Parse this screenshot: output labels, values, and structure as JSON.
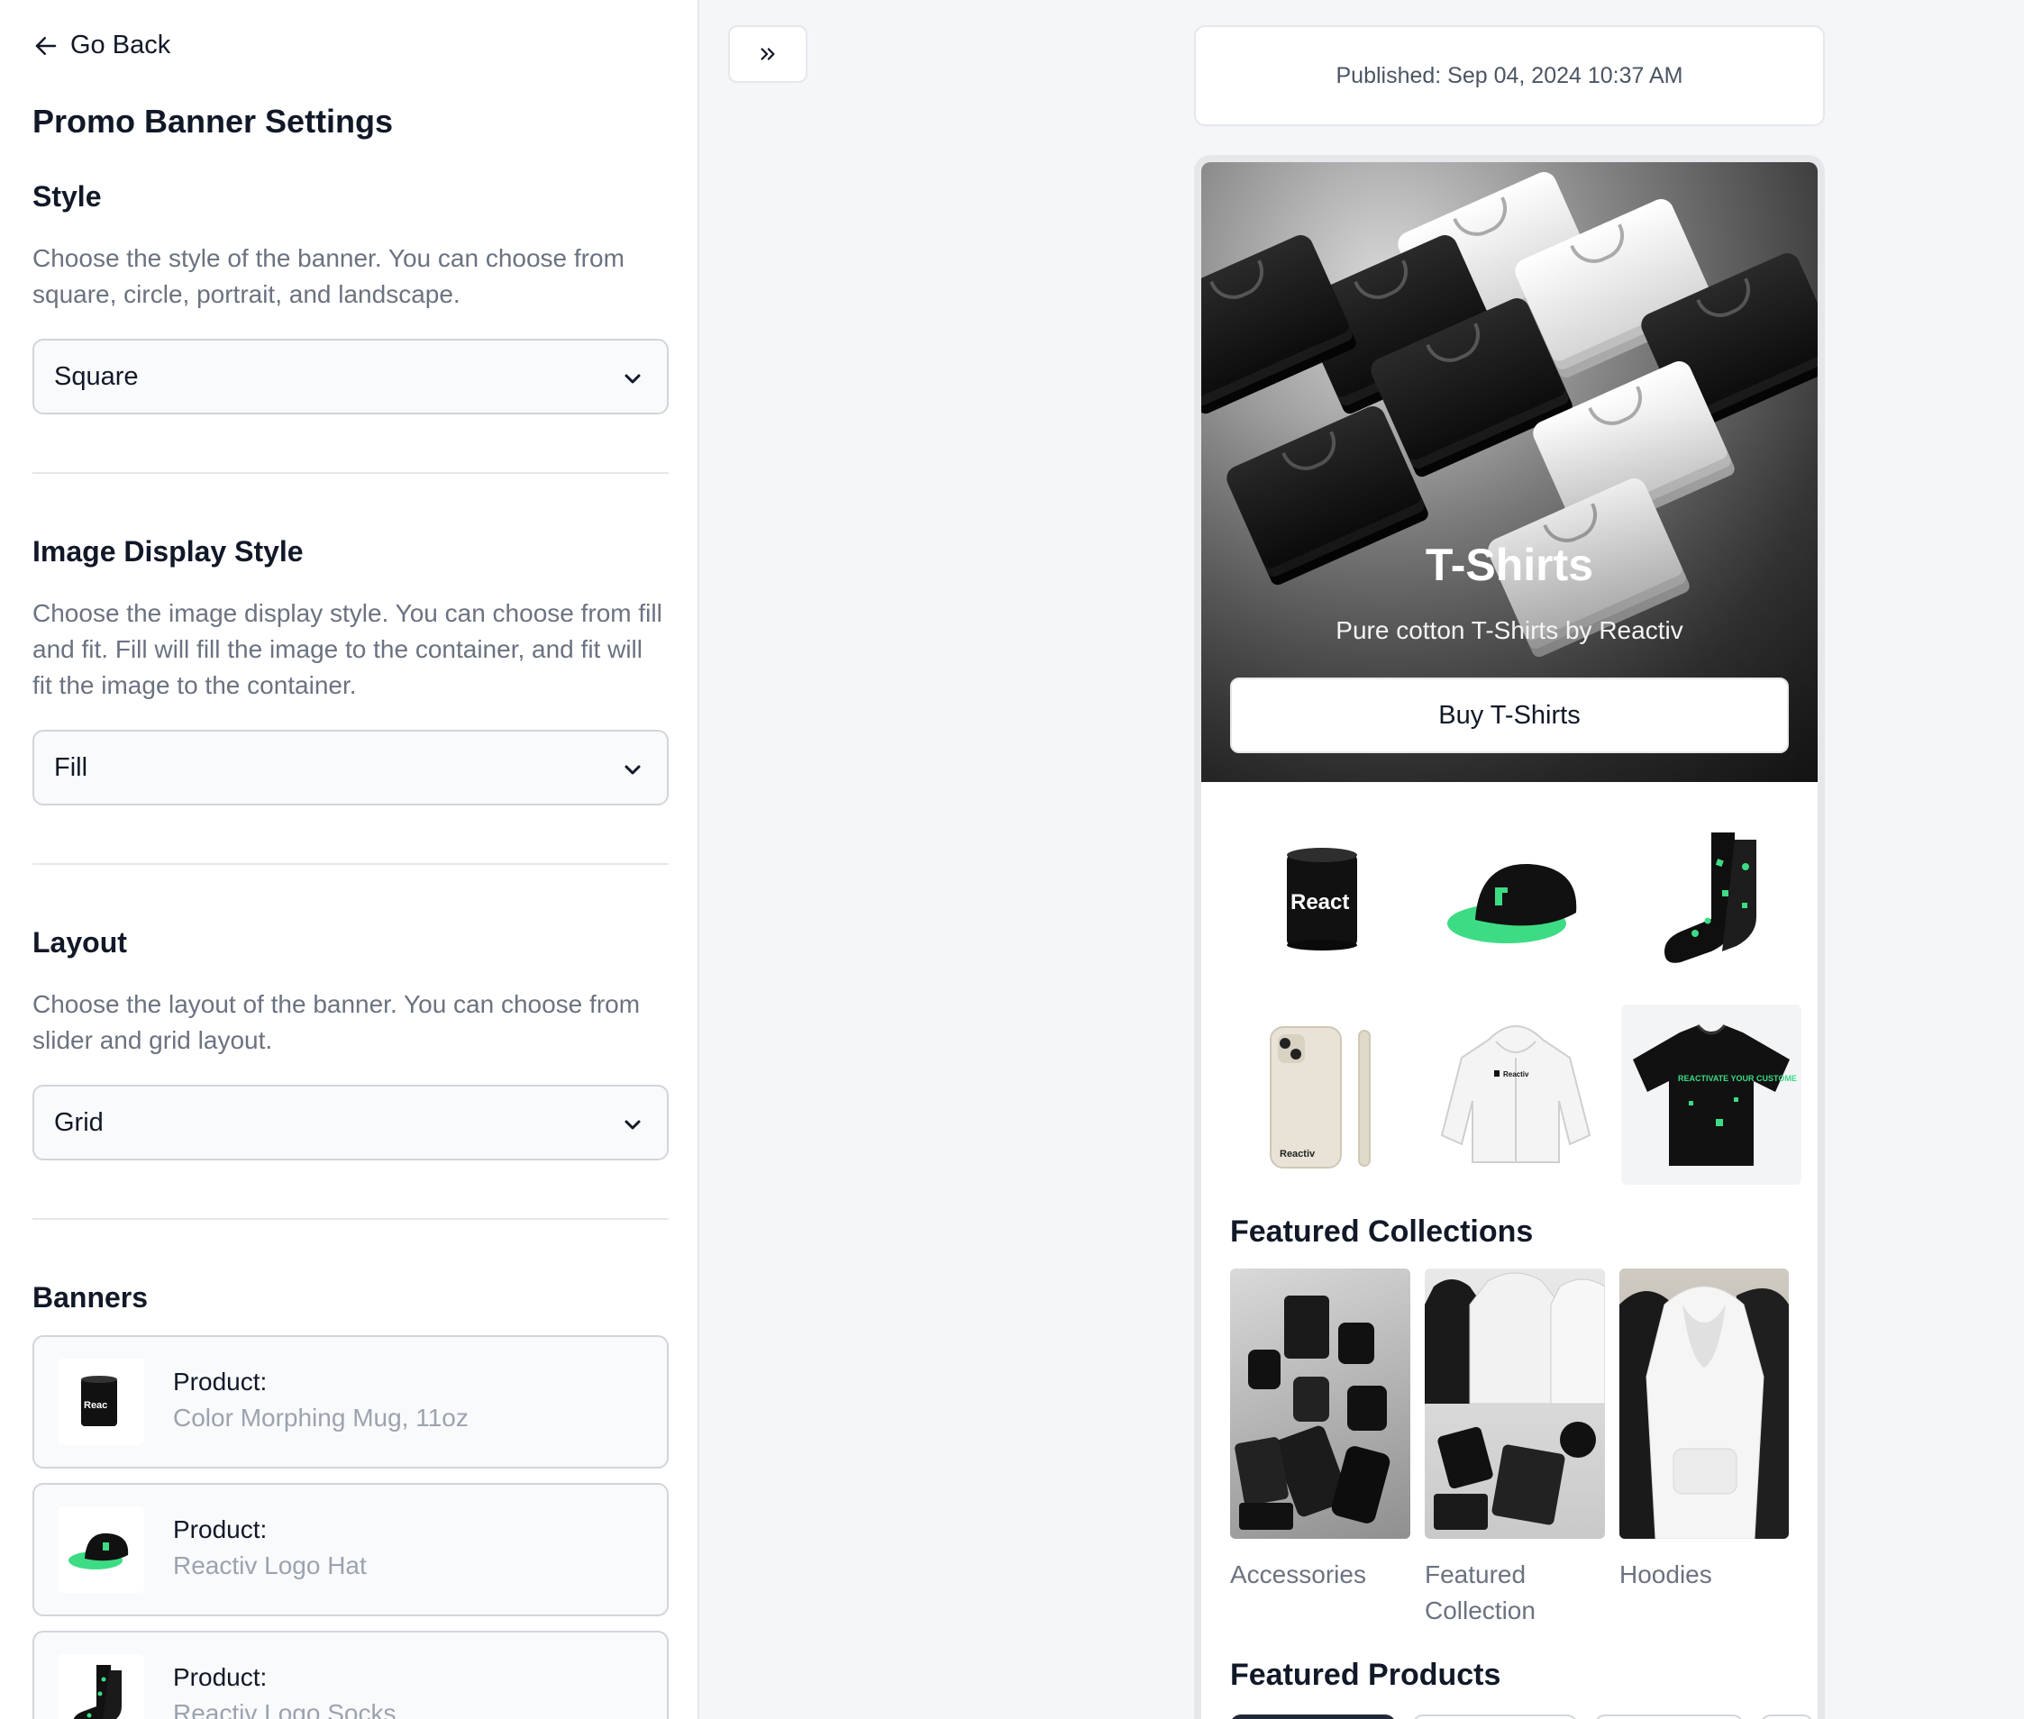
{
  "nav": {
    "back_label": "Go Back"
  },
  "panel": {
    "title": "Promo Banner Settings",
    "style": {
      "title": "Style",
      "description": "Choose the style of the banner. You can choose from square, circle, portrait, and landscape.",
      "value": "Square"
    },
    "image_display": {
      "title": "Image Display Style",
      "description": "Choose the image display style. You can choose from fill and fit. Fill will fill the image to the container, and fit will fit the image to the container.",
      "value": "Fill"
    },
    "layout": {
      "title": "Layout",
      "description": "Choose the layout of the banner. You can choose from slider and grid layout.",
      "value": "Grid"
    },
    "banners": {
      "title": "Banners",
      "items": [
        {
          "label": "Product:",
          "name": "Color Morphing Mug, 11oz",
          "icon": "mug-icon"
        },
        {
          "label": "Product:",
          "name": "Reactiv Logo Hat",
          "icon": "hat-icon"
        },
        {
          "label": "Product:",
          "name": "Reactiv Logo Socks",
          "icon": "socks-icon"
        }
      ]
    }
  },
  "preview": {
    "published": "Published: Sep 04, 2024 10:37 AM",
    "hero": {
      "title": "T-Shirts",
      "subtitle": "Pure cotton T-Shirts by Reactiv",
      "button": "Buy T-Shirts"
    },
    "grid_products": [
      {
        "icon": "mug-icon",
        "text": "React"
      },
      {
        "icon": "hat-icon"
      },
      {
        "icon": "socks-icon"
      },
      {
        "icon": "phone-case-icon",
        "text": "Reactiv"
      },
      {
        "icon": "hoodie-icon",
        "text": "Reactiv"
      },
      {
        "icon": "tshirt-icon",
        "text": "REACTIVATE YOUR CUSTOMERS"
      }
    ],
    "featured_collections": {
      "title": "Featured Collections",
      "items": [
        "Accessories",
        "Featured Collection",
        "Hoodies"
      ]
    },
    "featured_products": {
      "title": "Featured Products"
    }
  },
  "colors": {
    "brand_green": "#3ddc84",
    "dark": "#111111",
    "muted": "#6b7280"
  }
}
